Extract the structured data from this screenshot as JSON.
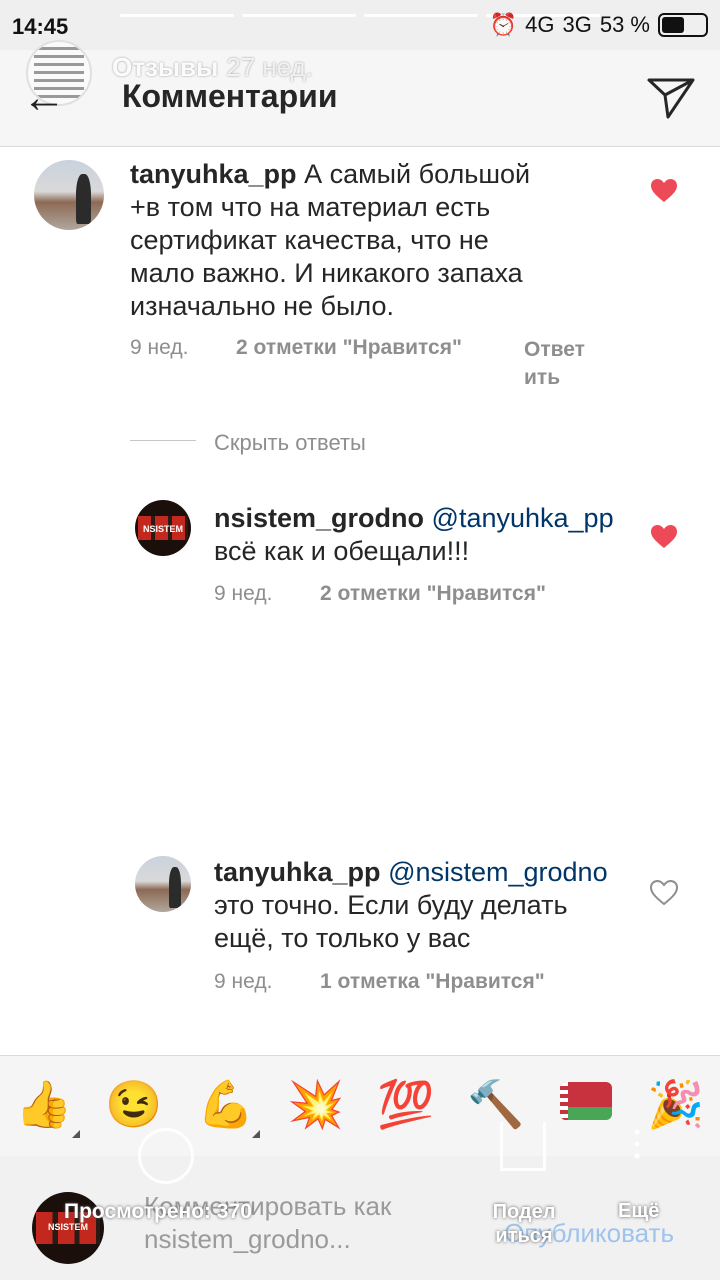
{
  "status_bar": {
    "time": "14:45",
    "network_1": "4G",
    "network_2": "3G",
    "battery": "53 %"
  },
  "header": {
    "stories_label": "Отзывы",
    "stories_age": "27 нед.",
    "title": "Комментарии",
    "back_icon": "back-arrow-icon",
    "send_icon": "direct-send-icon"
  },
  "comments": [
    {
      "username": "tanyuhka_pp",
      "mention": "",
      "text": "А самый большой +в том что на материал есть сертификат качества, что не мало важно. И никакого запаха изначально не было.",
      "time": "9 нед.",
      "likes": "2 отметки \"Нравится\"",
      "reply": "Ответить",
      "liked": true
    },
    {
      "username": "nsistem_grodno",
      "mention": "@tanyuhka_pp",
      "text": "всё как и обещали!!!",
      "time": "9 нед.",
      "likes": "2 отметки \"Нравится\"",
      "liked": true
    },
    {
      "username": "tanyuhka_pp",
      "mention": "@nsistem_grodno",
      "text": "это точно. Если буду делать ещё, то только у вас",
      "time": "9 нед.",
      "likes": "1 отметка \"Нравится\"",
      "liked": false
    }
  ],
  "hide_replies": "Скрыть ответы",
  "emoji_bar": [
    "👍",
    "😉",
    "💪",
    "💥",
    "💯",
    "🔨",
    "flag-belarus",
    "🎉"
  ],
  "composer": {
    "placeholder_line1": "Комментировать как",
    "placeholder_line2": "nsistem_grodno...",
    "publish": "Опубликовать"
  },
  "story_overlay": {
    "views": "Просмотрено: 370",
    "share": "Поделиться",
    "more": "Ещё"
  },
  "colors": {
    "heart_red": "#ed4956",
    "mention_blue": "#003569",
    "publish_blue": "#9ec4ee"
  }
}
